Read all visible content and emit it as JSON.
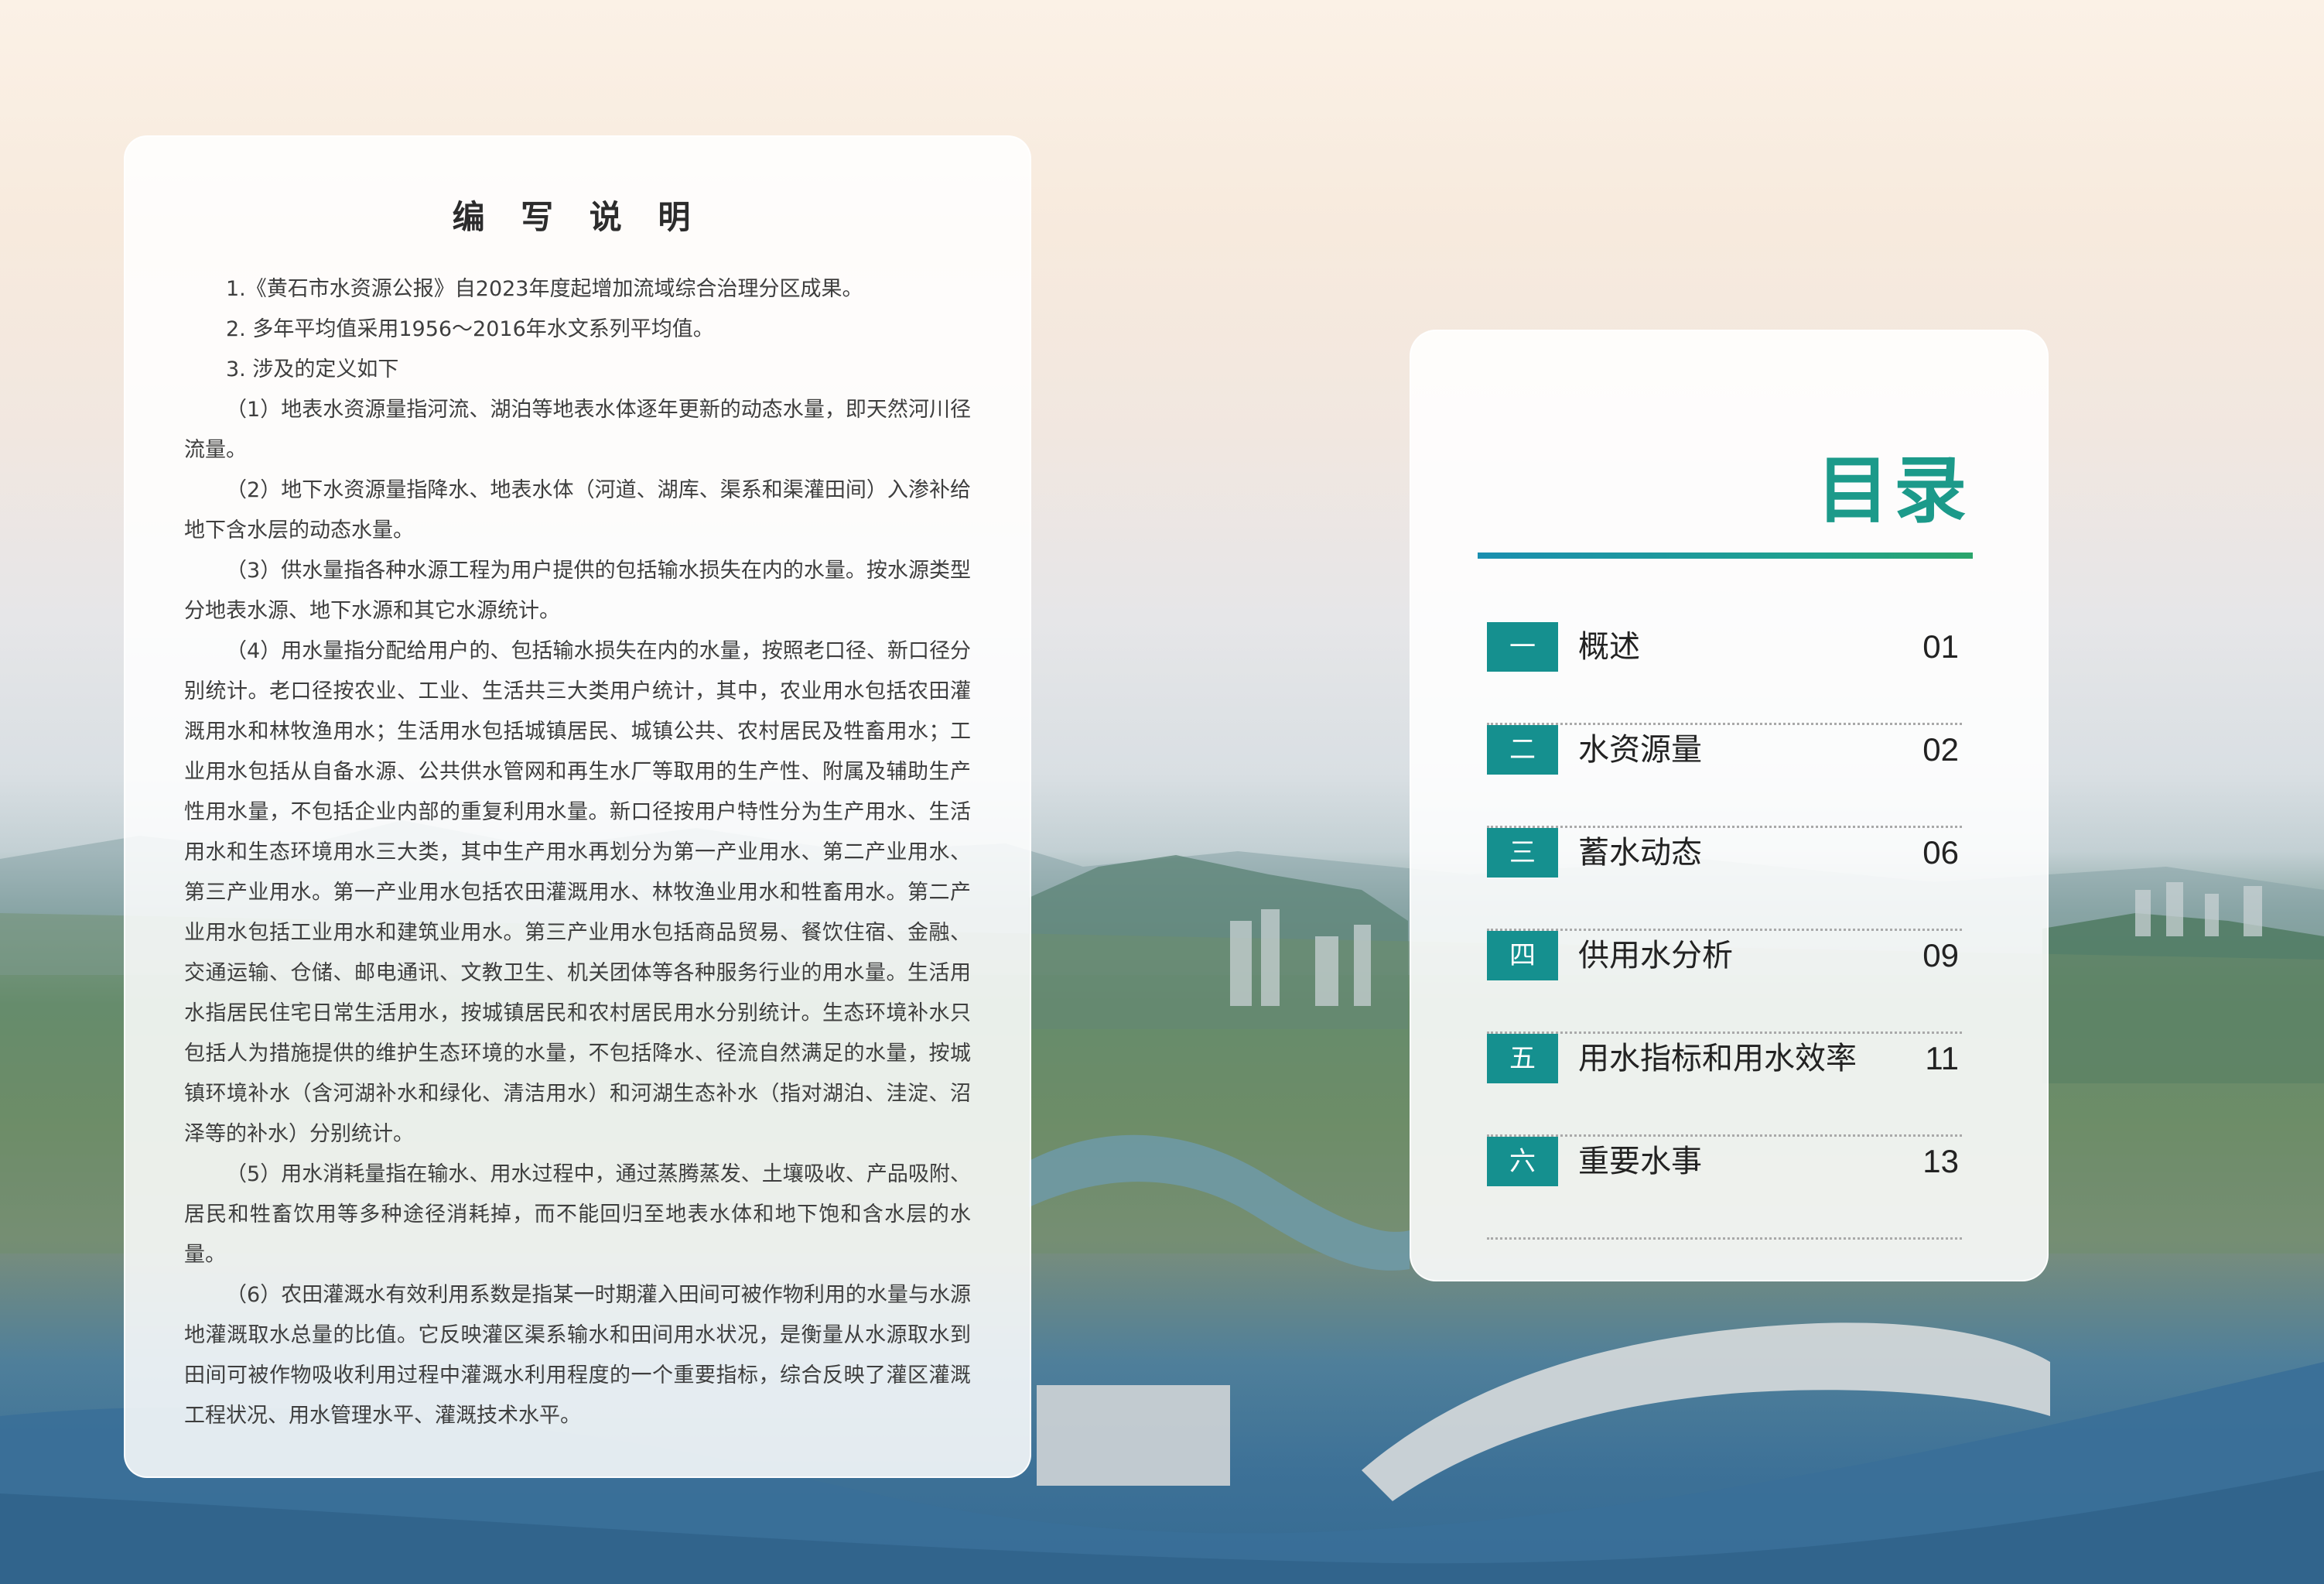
{
  "notes": {
    "title": "编 写 说 明",
    "paragraphs": [
      "1.《黄石市水资源公报》自2023年度起增加流域综合治理分区成果。",
      "2. 多年平均值采用1956～2016年水文系列平均值。",
      "3. 涉及的定义如下",
      "（1）地表水资源量指河流、湖泊等地表水体逐年更新的动态水量，即天然河川径流量。",
      "（2）地下水资源量指降水、地表水体（河道、湖库、渠系和渠灌田间）入渗补给地下含水层的动态水量。",
      "（3）供水量指各种水源工程为用户提供的包括输水损失在内的水量。按水源类型分地表水源、地下水源和其它水源统计。",
      "（4）用水量指分配给用户的、包括输水损失在内的水量，按照老口径、新口径分别统计。老口径按农业、工业、生活共三大类用户统计，其中，农业用水包括农田灌溉用水和林牧渔用水；生活用水包括城镇居民、城镇公共、农村居民及牲畜用水；工业用水包括从自备水源、公共供水管网和再生水厂等取用的生产性、附属及辅助生产性用水量，不包括企业内部的重复利用水量。新口径按用户特性分为生产用水、生活用水和生态环境用水三大类，其中生产用水再划分为第一产业用水、第二产业用水、第三产业用水。第一产业用水包括农田灌溉用水、林牧渔业用水和牲畜用水。第二产业用水包括工业用水和建筑业用水。第三产业用水包括商品贸易、餐饮住宿、金融、交通运输、仓储、邮电通讯、文教卫生、机关团体等各种服务行业的用水量。生活用水指居民住宅日常生活用水，按城镇居民和农村居民用水分别统计。生态环境补水只包括人为措施提供的维护生态环境的水量，不包括降水、径流自然满足的水量，按城镇环境补水（含河湖补水和绿化、清洁用水）和河湖生态补水（指对湖泊、洼淀、沼泽等的补水）分别统计。",
      "（5）用水消耗量指在输水、用水过程中，通过蒸腾蒸发、土壤吸收、产品吸附、居民和牲畜饮用等多种途径消耗掉，而不能回归至地表水体和地下饱和含水层的水量。",
      "（6）农田灌溉水有效利用系数是指某一时期灌入田间可被作物利用的水量与水源地灌溉取水总量的比值。它反映灌区渠系输水和田间用水状况，是衡量从水源取水到田间可被作物吸收利用过程中灌溉水利用程度的一个重要指标，综合反映了灌区灌溉工程状况、用水管理水平、灌溉技术水平。"
    ]
  },
  "toc": {
    "title": "目录",
    "items": [
      {
        "num": "一",
        "label": "概述",
        "page": "01"
      },
      {
        "num": "二",
        "label": "水资源量",
        "page": "02"
      },
      {
        "num": "三",
        "label": "蓄水动态",
        "page": "06"
      },
      {
        "num": "四",
        "label": "供用水分析",
        "page": "09"
      },
      {
        "num": "五",
        "label": "用水指标和用水效率",
        "page": "11"
      },
      {
        "num": "六",
        "label": "重要水事",
        "page": "13"
      }
    ]
  }
}
